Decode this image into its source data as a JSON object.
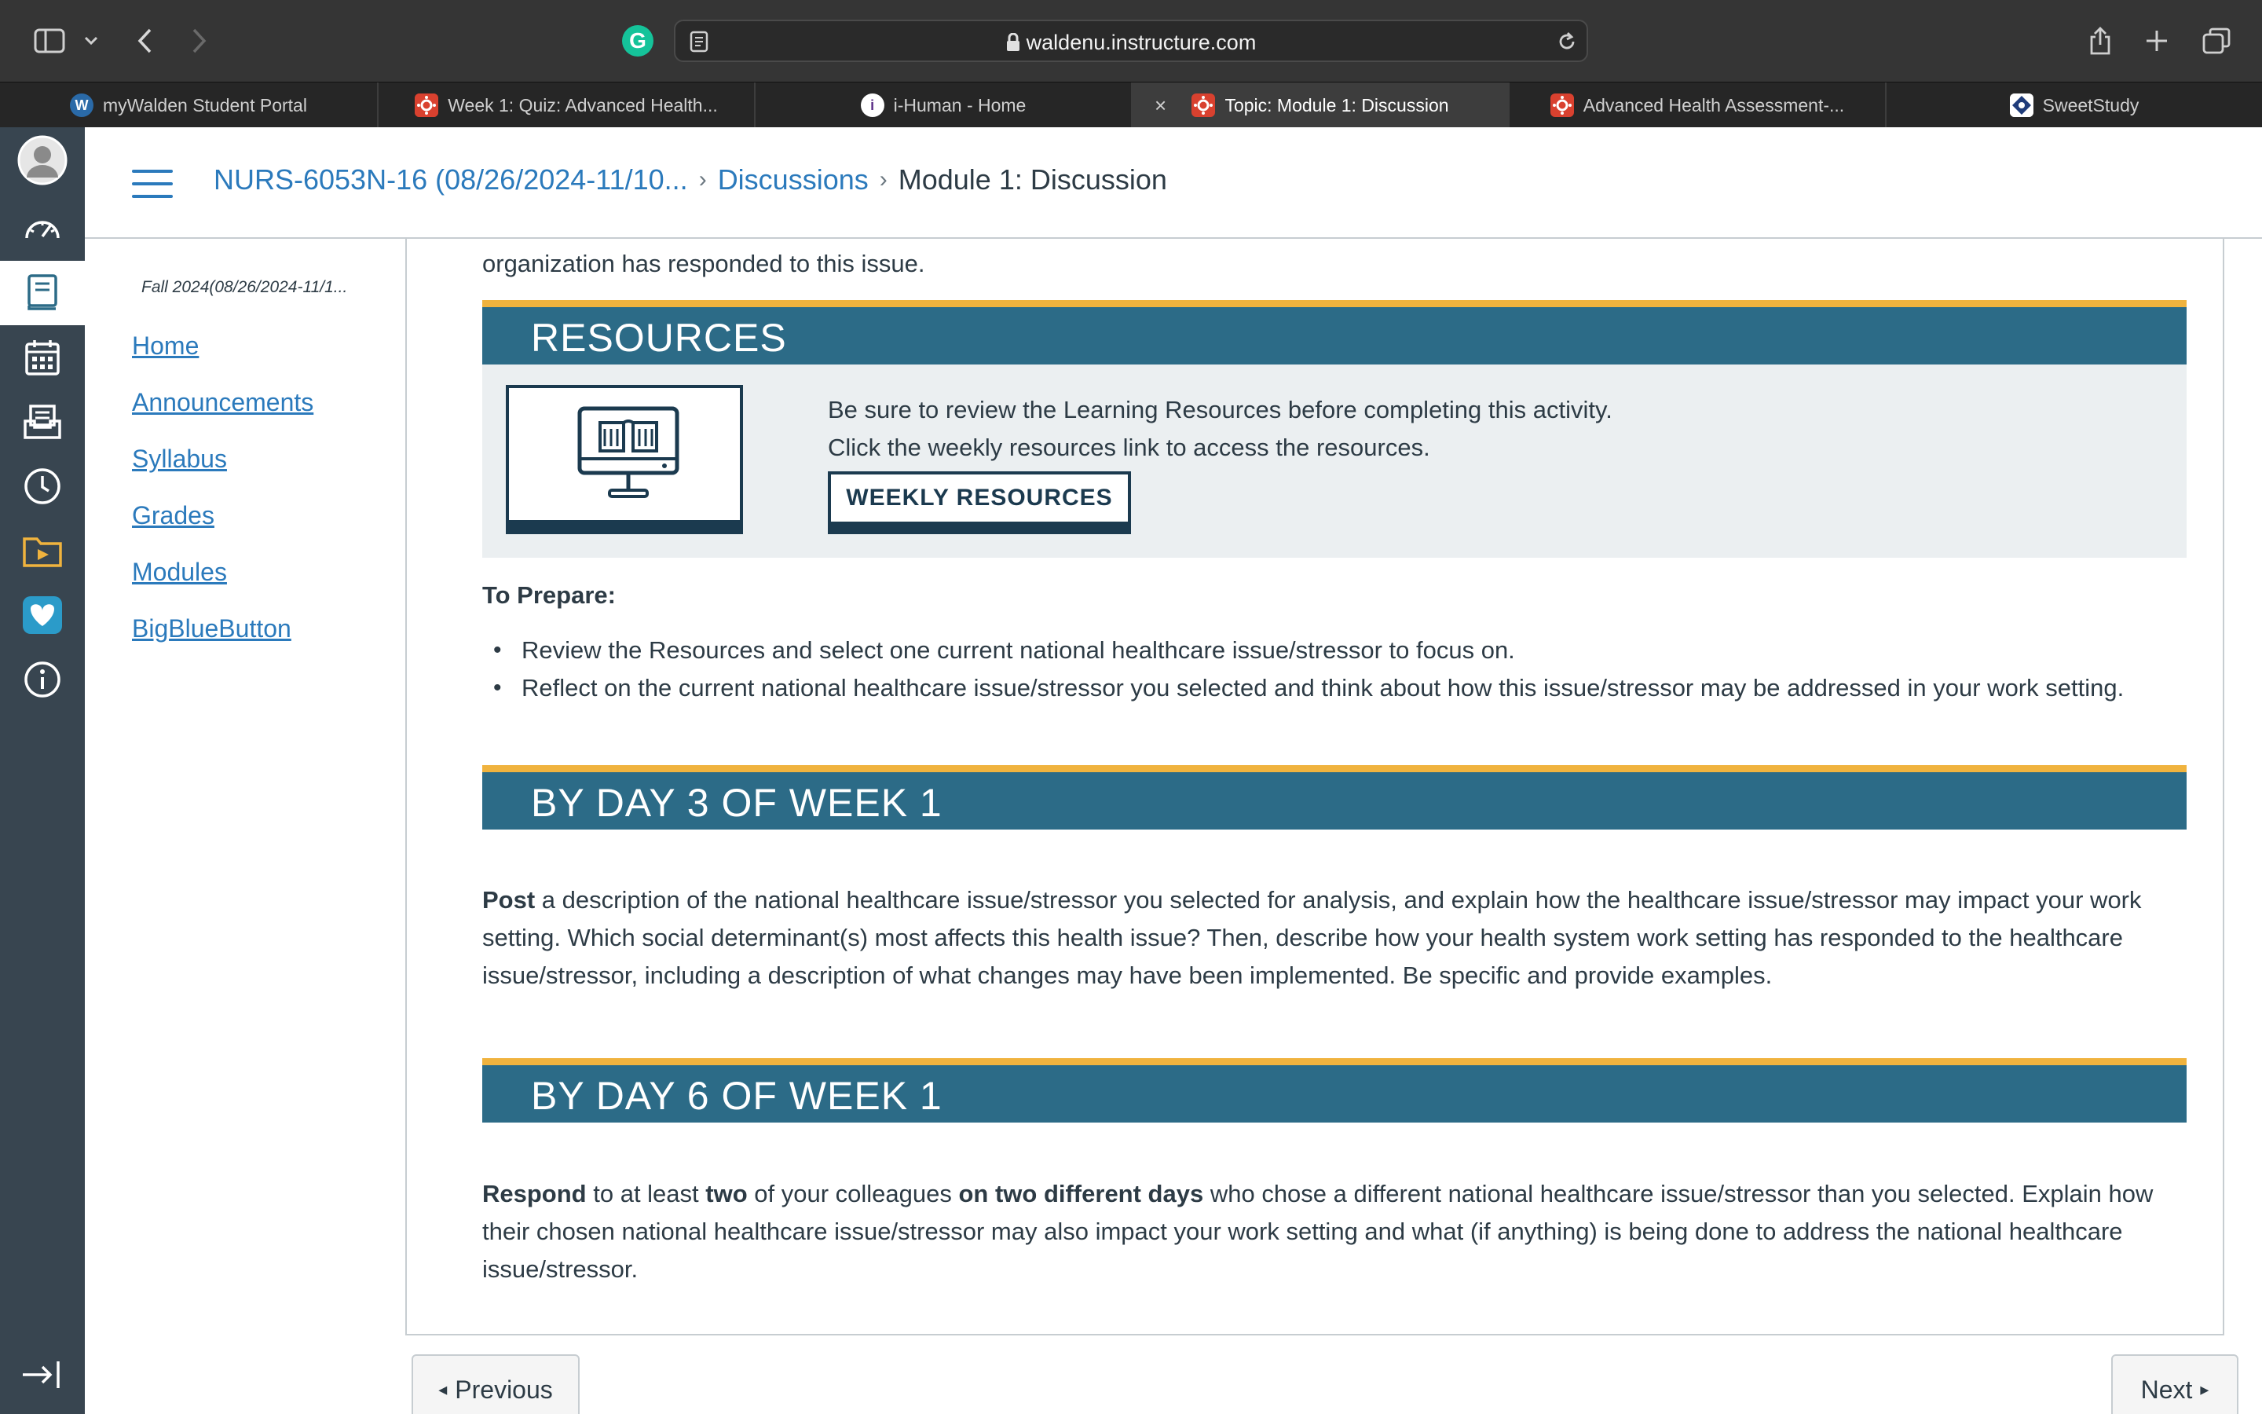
{
  "browser": {
    "url": "waldenu.instructure.com",
    "tabs": [
      {
        "label": "myWalden Student Portal",
        "icon": "walden-w-icon"
      },
      {
        "label": "Week 1: Quiz: Advanced Health...",
        "icon": "canvas-icon"
      },
      {
        "label": "i-Human - Home",
        "icon": "ihuman-icon"
      },
      {
        "label": "Topic: Module 1: Discussion",
        "icon": "canvas-icon",
        "active": true
      },
      {
        "label": "Advanced Health Assessment-...",
        "icon": "canvas-icon"
      },
      {
        "label": "SweetStudy",
        "icon": "sweetstudy-icon"
      }
    ],
    "tab_close_glyph": "×"
  },
  "global_nav": {
    "items": [
      "account",
      "dashboard",
      "courses",
      "calendar",
      "inbox",
      "history",
      "commons",
      "studio",
      "help"
    ]
  },
  "header": {
    "course": "NURS-6053N-16 (08/26/2024-11/10...",
    "discussions": "Discussions",
    "current": "Module 1: Discussion",
    "sep": "›"
  },
  "course_nav": {
    "term": "Fall 2024(08/26/2024-11/1...",
    "links": [
      "Home",
      "Announcements",
      "Syllabus",
      "Grades",
      "Modules",
      "BigBlueButton"
    ]
  },
  "content": {
    "intro_tail": "organization has responded to this issue.",
    "resources": {
      "title": "RESOURCES",
      "line1": "Be sure to review the Learning Resources before completing this activity.",
      "line2": "Click the weekly resources link to access the resources.",
      "button": "WEEKLY RESOURCES"
    },
    "prepare": {
      "heading": "To Prepare:",
      "bullets": [
        "Review the Resources and select one current national healthcare issue/stressor to focus on.",
        "Reflect on the current national healthcare issue/stressor you selected and think about how this issue/stressor may be addressed in your work setting."
      ]
    },
    "day3": {
      "title": "BY DAY 3 OF WEEK 1",
      "bold": "Post",
      "text": " a description of the national healthcare issue/stressor you selected for analysis, and explain how the healthcare issue/stressor may impact your work setting. Which social determinant(s) most affects this health issue? Then, describe how your health system work setting has responded to the healthcare issue/stressor, including a description of what changes may have been implemented. Be specific and provide examples."
    },
    "day6": {
      "title": "BY DAY 6 OF WEEK 1",
      "b1": "Respond",
      "t1": " to at least ",
      "b2": "two",
      "t2": " of your colleagues ",
      "b3": "on two different days",
      "t3": " who chose a different national healthcare issue/stressor than you selected. Explain how their chosen national healthcare issue/stressor may also impact your work setting and what (if anything) is being done to address the national healthcare issue/stressor."
    }
  },
  "footer": {
    "previous": "Previous",
    "next": "Next",
    "prev_glyph": "◂",
    "next_glyph": "▸"
  },
  "colors": {
    "banner": "#2c6b87",
    "banner_accent": "#f0b33e",
    "link": "#2b7abc",
    "global_nav": "#384550"
  }
}
